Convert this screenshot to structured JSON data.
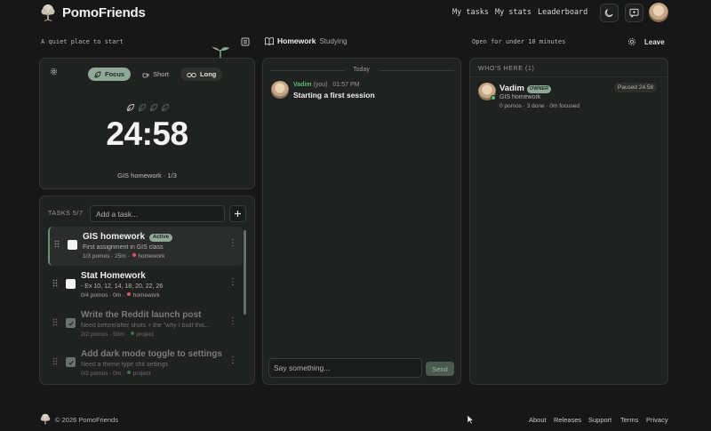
{
  "brand": {
    "name": "PomoFriends"
  },
  "nav": {
    "my_tasks": "My tasks",
    "my_stats": "My stats",
    "leaderboard": "Leaderboard"
  },
  "subbar": {
    "tagline": "A quiet place to start",
    "room_name": "Homework",
    "room_status": "Studying",
    "open_for": "Open for under 10 minutes",
    "leave": "Leave"
  },
  "timer": {
    "modes": [
      {
        "label": "Focus",
        "active": true
      },
      {
        "label": "Short",
        "active": false
      },
      {
        "label": "Long",
        "active": false
      }
    ],
    "time": "24:58",
    "current_task": "GIS homework · 1/3",
    "pomos_total": 4,
    "pomos_done": 1
  },
  "tasks": {
    "label": "TASKS 5/7",
    "add_placeholder": "Add a task...",
    "items": [
      {
        "title": "GIS homework",
        "badge": "Active",
        "desc": "First assignment in GIS class",
        "meta": "1/3 pomos · 25m · ",
        "tag": "homework",
        "tag_color": "#e0556a",
        "done": false
      },
      {
        "title": "Stat Homework",
        "desc": "- Ex 10, 12, 14, 18, 20, 22, 26",
        "meta": "0/4 pomos · 0m · ",
        "tag": "homework",
        "tag_color": "#e0556a",
        "done": false
      },
      {
        "title": "Write the Reddit launch post",
        "desc": "Need before/after shots + the \"why I built this...",
        "meta": "2/2 pomos · 50m · ",
        "tag": "project",
        "tag_color": "#5aa86a",
        "done": true
      },
      {
        "title": "Add dark mode toggle to settings",
        "desc": "Need a theme type shit settings",
        "meta": "0/2 pomos · 0m · ",
        "tag": "project",
        "tag_color": "#5aa86a",
        "done": true
      }
    ]
  },
  "chat": {
    "day_label": "Today",
    "messages": [
      {
        "author": "Vadim",
        "you": "(you)",
        "time": "01:57 PM",
        "text": "Starting a first session"
      }
    ],
    "input_placeholder": "Say something...",
    "send": "Send"
  },
  "who": {
    "label": "WHO'S HERE (1)",
    "members": [
      {
        "name": "Vadim",
        "role": "OWNER",
        "task": "GIS homework",
        "stats": "0 pomos · 3 done · 0m focused",
        "status": "Paused 24:58"
      }
    ]
  },
  "footer": {
    "copyright": "© 2026 PomoFriends",
    "links": [
      "About",
      "Releases",
      "Support",
      "Terms",
      "Privacy"
    ]
  },
  "colors": {
    "accent": "#8ea998",
    "background": "#161716",
    "card": "#202221"
  }
}
